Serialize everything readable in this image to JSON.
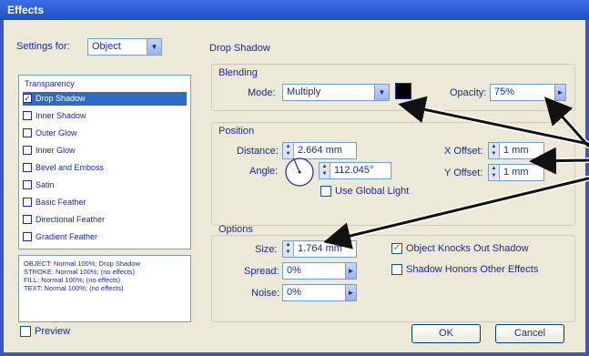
{
  "window": {
    "title": "Effects"
  },
  "settings": {
    "label": "Settings for:",
    "value": "Object"
  },
  "effects_list": {
    "header": "Transparency",
    "items": [
      {
        "label": "Drop Shadow",
        "checked": true,
        "selected": true
      },
      {
        "label": "Inner Shadow",
        "checked": false,
        "selected": false
      },
      {
        "label": "Outer Glow",
        "checked": false,
        "selected": false
      },
      {
        "label": "Inner Glow",
        "checked": false,
        "selected": false
      },
      {
        "label": "Bevel and Emboss",
        "checked": false,
        "selected": false
      },
      {
        "label": "Satin",
        "checked": false,
        "selected": false
      },
      {
        "label": "Basic Feather",
        "checked": false,
        "selected": false
      },
      {
        "label": "Directional Feather",
        "checked": false,
        "selected": false
      },
      {
        "label": "Gradient Feather",
        "checked": false,
        "selected": false
      }
    ]
  },
  "summary": [
    "OBJECT: Normal 100%; Drop Shadow",
    "STROKE: Normal 100%; (no effects)",
    "FILL: Normal 100%; (no effects)",
    "TEXT: Normal 100%; (no effects)"
  ],
  "panel": {
    "title": "Drop Shadow",
    "blending": {
      "heading": "Blending",
      "mode_label": "Mode:",
      "mode_value": "Multiply",
      "opacity_label": "Opacity:",
      "opacity_value": "75%"
    },
    "position": {
      "heading": "Position",
      "distance_label": "Distance:",
      "distance_value": "2.664 mm",
      "angle_label": "Angle:",
      "angle_value": "112.045°",
      "global_light_label": "Use Global Light",
      "x_offset_label": "X Offset:",
      "x_offset_value": "1 mm",
      "y_offset_label": "Y Offset:",
      "y_offset_value": "1 mm"
    },
    "options": {
      "heading": "Options",
      "size_label": "Size:",
      "size_value": "1.764 mm",
      "spread_label": "Spread:",
      "spread_value": "0%",
      "noise_label": "Noise:",
      "noise_value": "0%",
      "knocks_out_label": "Object Knocks Out Shadow",
      "knocks_out_checked": true,
      "honors_label": "Shadow Honors Other Effects",
      "honors_checked": false
    }
  },
  "footer": {
    "preview_label": "Preview",
    "preview_checked": false,
    "ok_label": "OK",
    "cancel_label": "Cancel"
  },
  "colors": {
    "shadow_swatch": "#000000",
    "label_text": "#1b2a9c",
    "dialog_bg": "#ece9d8",
    "titlebar": "#1f4fc7"
  }
}
